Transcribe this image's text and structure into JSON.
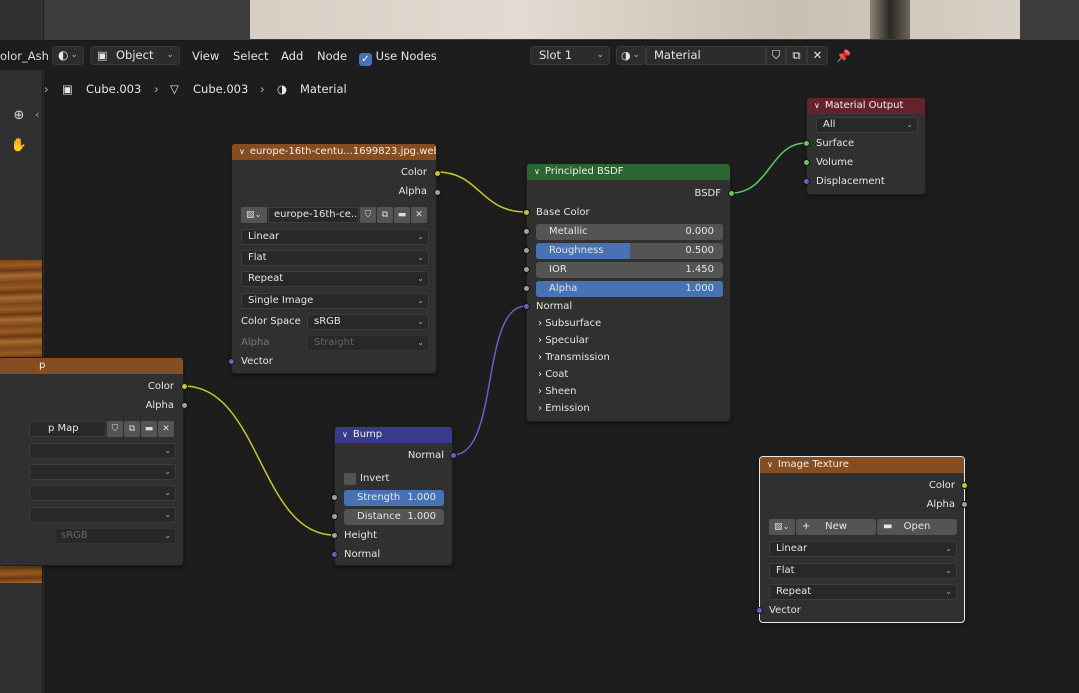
{
  "header": {
    "editor_name": "olor_Ash",
    "mode": "Object",
    "menu": [
      "View",
      "Select",
      "Add",
      "Node"
    ],
    "use_nodes_label": "Use Nodes",
    "use_nodes_checked": true,
    "slot": "Slot 1",
    "material_name": "Material"
  },
  "breadcrumb": {
    "object": "Cube.003",
    "mesh": "Cube.003",
    "material": "Material"
  },
  "nodes": {
    "image_texture_1": {
      "title": "europe-16th-centu...1699823.jpg.webp",
      "out_color": "Color",
      "out_alpha": "Alpha",
      "image_name": "europe-16th-ce...",
      "interpolation": "Linear",
      "projection": "Flat",
      "extension": "Repeat",
      "source": "Single Image",
      "color_space_label": "Color Space",
      "color_space": "sRGB",
      "alpha_label": "Alpha",
      "alpha_mode": "Straight",
      "in_vector": "Vector"
    },
    "image_texture_2": {
      "title": "p",
      "out_color": "Color",
      "out_alpha": "Alpha",
      "image_name": "p Map",
      "color_space": "sRGB"
    },
    "bsdf": {
      "title": "Principled BSDF",
      "out_bsdf": "BSDF",
      "base_color": "Base Color",
      "metallic_label": "Metallic",
      "metallic": "0.000",
      "metallic_fraction": 0.0,
      "roughness_label": "Roughness",
      "roughness": "0.500",
      "roughness_fraction": 0.5,
      "ior_label": "IOR",
      "ior": "1.450",
      "ior_fraction": 0.0,
      "alpha_label": "Alpha",
      "alpha": "1.000",
      "alpha_fraction": 1.0,
      "normal": "Normal",
      "panels": [
        "Subsurface",
        "Specular",
        "Transmission",
        "Coat",
        "Sheen",
        "Emission"
      ]
    },
    "material_output": {
      "title": "Material Output",
      "target": "All",
      "surface": "Surface",
      "volume": "Volume",
      "displacement": "Displacement"
    },
    "bump": {
      "title": "Bump",
      "out_normal": "Normal",
      "invert_label": "Invert",
      "strength_label": "Strength",
      "strength": "1.000",
      "strength_fraction": 1.0,
      "distance_label": "Distance",
      "distance": "1.000",
      "distance_fraction": 0.0,
      "in_height": "Height",
      "in_normal": "Normal"
    },
    "image_texture_3": {
      "title": "Image Texture",
      "out_color": "Color",
      "out_alpha": "Alpha",
      "new_label": "New",
      "open_label": "Open",
      "interpolation": "Linear",
      "projection": "Flat",
      "extension": "Repeat",
      "in_vector": "Vector"
    }
  },
  "colors": {
    "socket_color": "#c7c729",
    "socket_float": "#a1a1a1",
    "socket_vector": "#6363c7",
    "socket_shader": "#63c763",
    "header_texture": "#854d20",
    "header_shader": "#2b6531",
    "header_output": "#65222c",
    "header_vector": "#3a3a8c",
    "accent": "#4772b3"
  }
}
